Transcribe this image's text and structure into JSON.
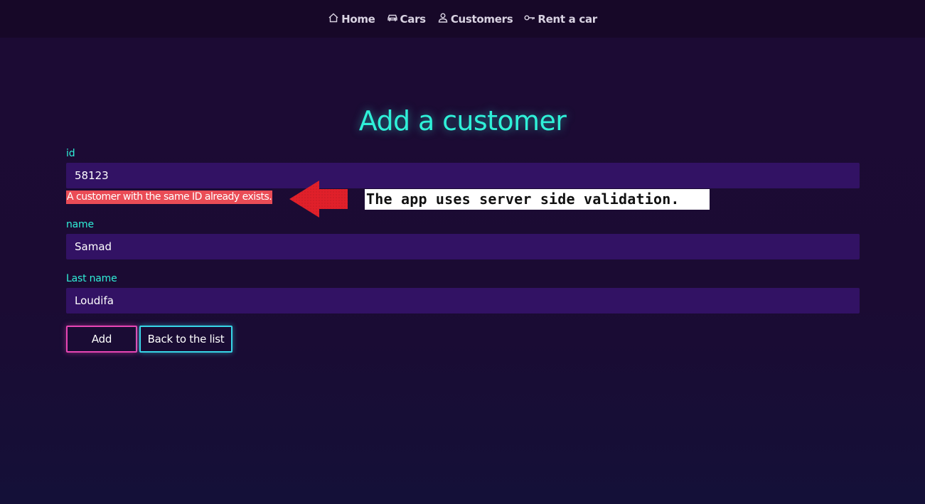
{
  "nav": {
    "items": [
      {
        "label": "Home",
        "icon": "home-icon"
      },
      {
        "label": "Cars",
        "icon": "car-icon"
      },
      {
        "label": "Customers",
        "icon": "user-icon"
      },
      {
        "label": "Rent a car",
        "icon": "key-icon"
      }
    ]
  },
  "page": {
    "title": "Add a customer"
  },
  "form": {
    "id": {
      "label": "id",
      "value": "58123"
    },
    "error": "A customer with the same ID already exists.",
    "name": {
      "label": "name",
      "value": "Samad"
    },
    "last_name": {
      "label": "Last name",
      "value": "Loudifa"
    },
    "add_label": "Add",
    "back_label": "Back to the list"
  },
  "annotation": {
    "text": "The app uses server side validation."
  },
  "colors": {
    "accent_cyan": "#2ff0d8",
    "accent_pink": "#e845b4",
    "input_bg": "#321264",
    "error_bg": "#ea4c56",
    "arrow_red": "#e0202a"
  }
}
